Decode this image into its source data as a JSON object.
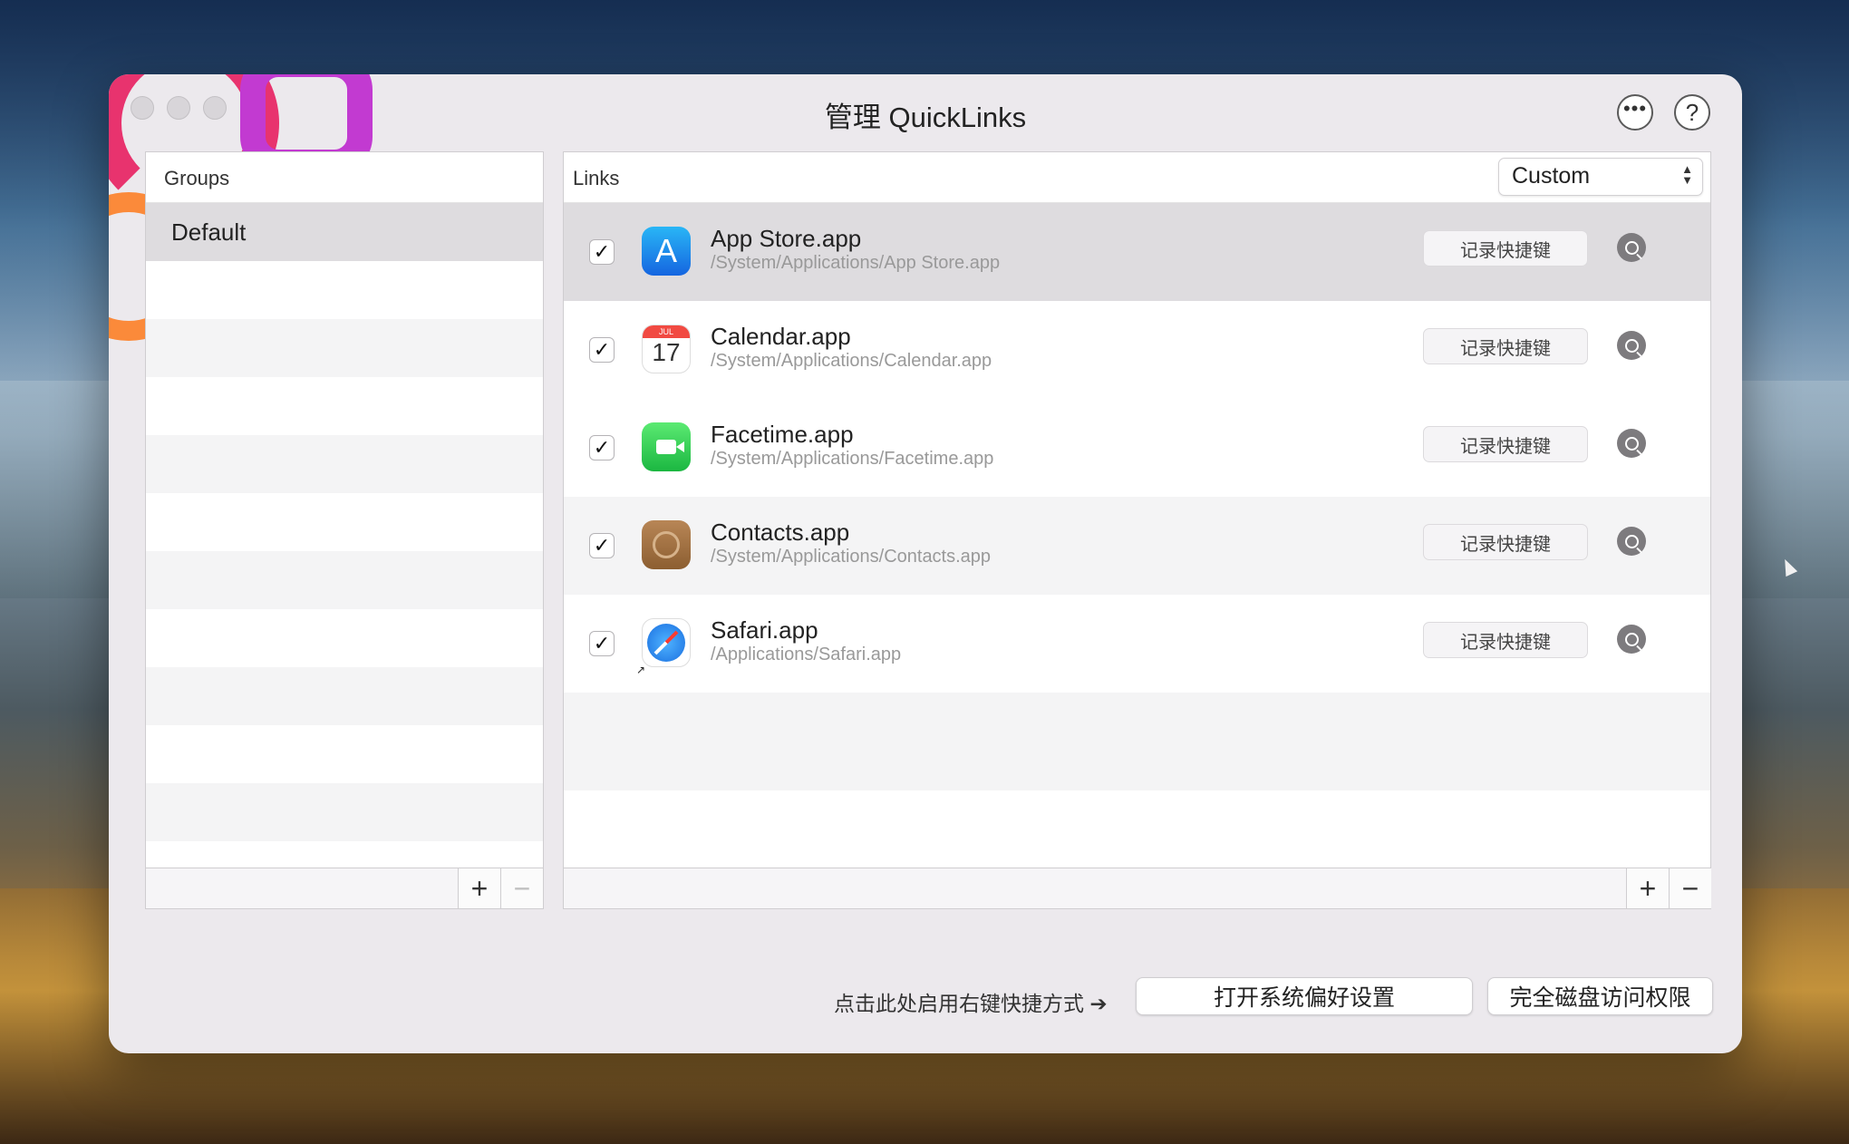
{
  "window": {
    "title": "管理 QuickLinks",
    "more_icon": "ellipsis-circle-icon",
    "help_label": "?"
  },
  "groups": {
    "header": "Groups",
    "items": [
      {
        "label": "Default",
        "selected": true
      }
    ],
    "add_label": "+",
    "remove_label": "−"
  },
  "links": {
    "header": "Links",
    "sort": {
      "value": "Custom"
    },
    "record_label": "记录快捷键",
    "items": [
      {
        "enabled": true,
        "name": "App Store.app",
        "path": "/System/Applications/App Store.app",
        "icon": "app-store-icon",
        "selected": true
      },
      {
        "enabled": true,
        "name": "Calendar.app",
        "path": "/System/Applications/Calendar.app",
        "icon": "calendar-icon",
        "cal_month": "JUL",
        "cal_day": "17"
      },
      {
        "enabled": true,
        "name": "Facetime.app",
        "path": "/System/Applications/Facetime.app",
        "icon": "facetime-icon"
      },
      {
        "enabled": true,
        "name": "Contacts.app",
        "path": "/System/Applications/Contacts.app",
        "icon": "contacts-icon"
      },
      {
        "enabled": true,
        "name": "Safari.app",
        "path": "/Applications/Safari.app",
        "icon": "safari-icon"
      }
    ],
    "add_label": "+",
    "remove_label": "−"
  },
  "bottom": {
    "hint": "点击此处启用右键快捷方式 ➔",
    "open_prefs_label": "打开系统偏好设置",
    "full_disk_label": "完全磁盘访问权限"
  }
}
